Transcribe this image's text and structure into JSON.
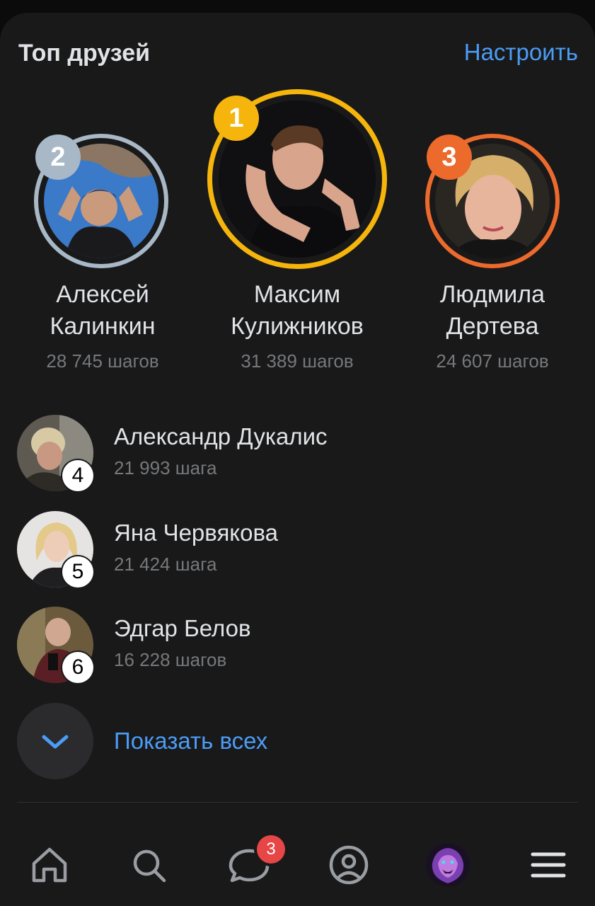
{
  "header": {
    "title": "Топ друзей",
    "action": "Настроить"
  },
  "colors": {
    "accent": "#4b9cf5",
    "gold": "#f5b50c",
    "silver": "#a8b8c6",
    "bronze": "#ec6a2c",
    "badge": "#e64646"
  },
  "podium": [
    {
      "rank": "1",
      "first_name": "Максим",
      "last_name": "Кулижников",
      "steps": "31 389 шагов"
    },
    {
      "rank": "2",
      "first_name": "Алексей",
      "last_name": "Калинкин",
      "steps": "28 745 шагов"
    },
    {
      "rank": "3",
      "first_name": "Людмила",
      "last_name": "Дертева",
      "steps": "24 607 шагов"
    }
  ],
  "list": [
    {
      "rank": "4",
      "name": "Александр Дукалис",
      "steps": "21 993 шага"
    },
    {
      "rank": "5",
      "name": "Яна Червякова",
      "steps": "21 424 шага"
    },
    {
      "rank": "6",
      "name": "Эдгар Белов",
      "steps": "16 228 шагов"
    }
  ],
  "show_all": {
    "label": "Показать всех",
    "icon": "chevron-down-icon"
  },
  "tabbar": {
    "items": [
      {
        "name": "home",
        "icon": "home-icon"
      },
      {
        "name": "search",
        "icon": "search-icon"
      },
      {
        "name": "messages",
        "icon": "chat-bubble-icon",
        "badge": "3"
      },
      {
        "name": "profile",
        "icon": "user-circle-icon"
      },
      {
        "name": "services",
        "icon": "lion-avatar-icon"
      },
      {
        "name": "menu",
        "icon": "hamburger-menu-icon"
      }
    ]
  }
}
